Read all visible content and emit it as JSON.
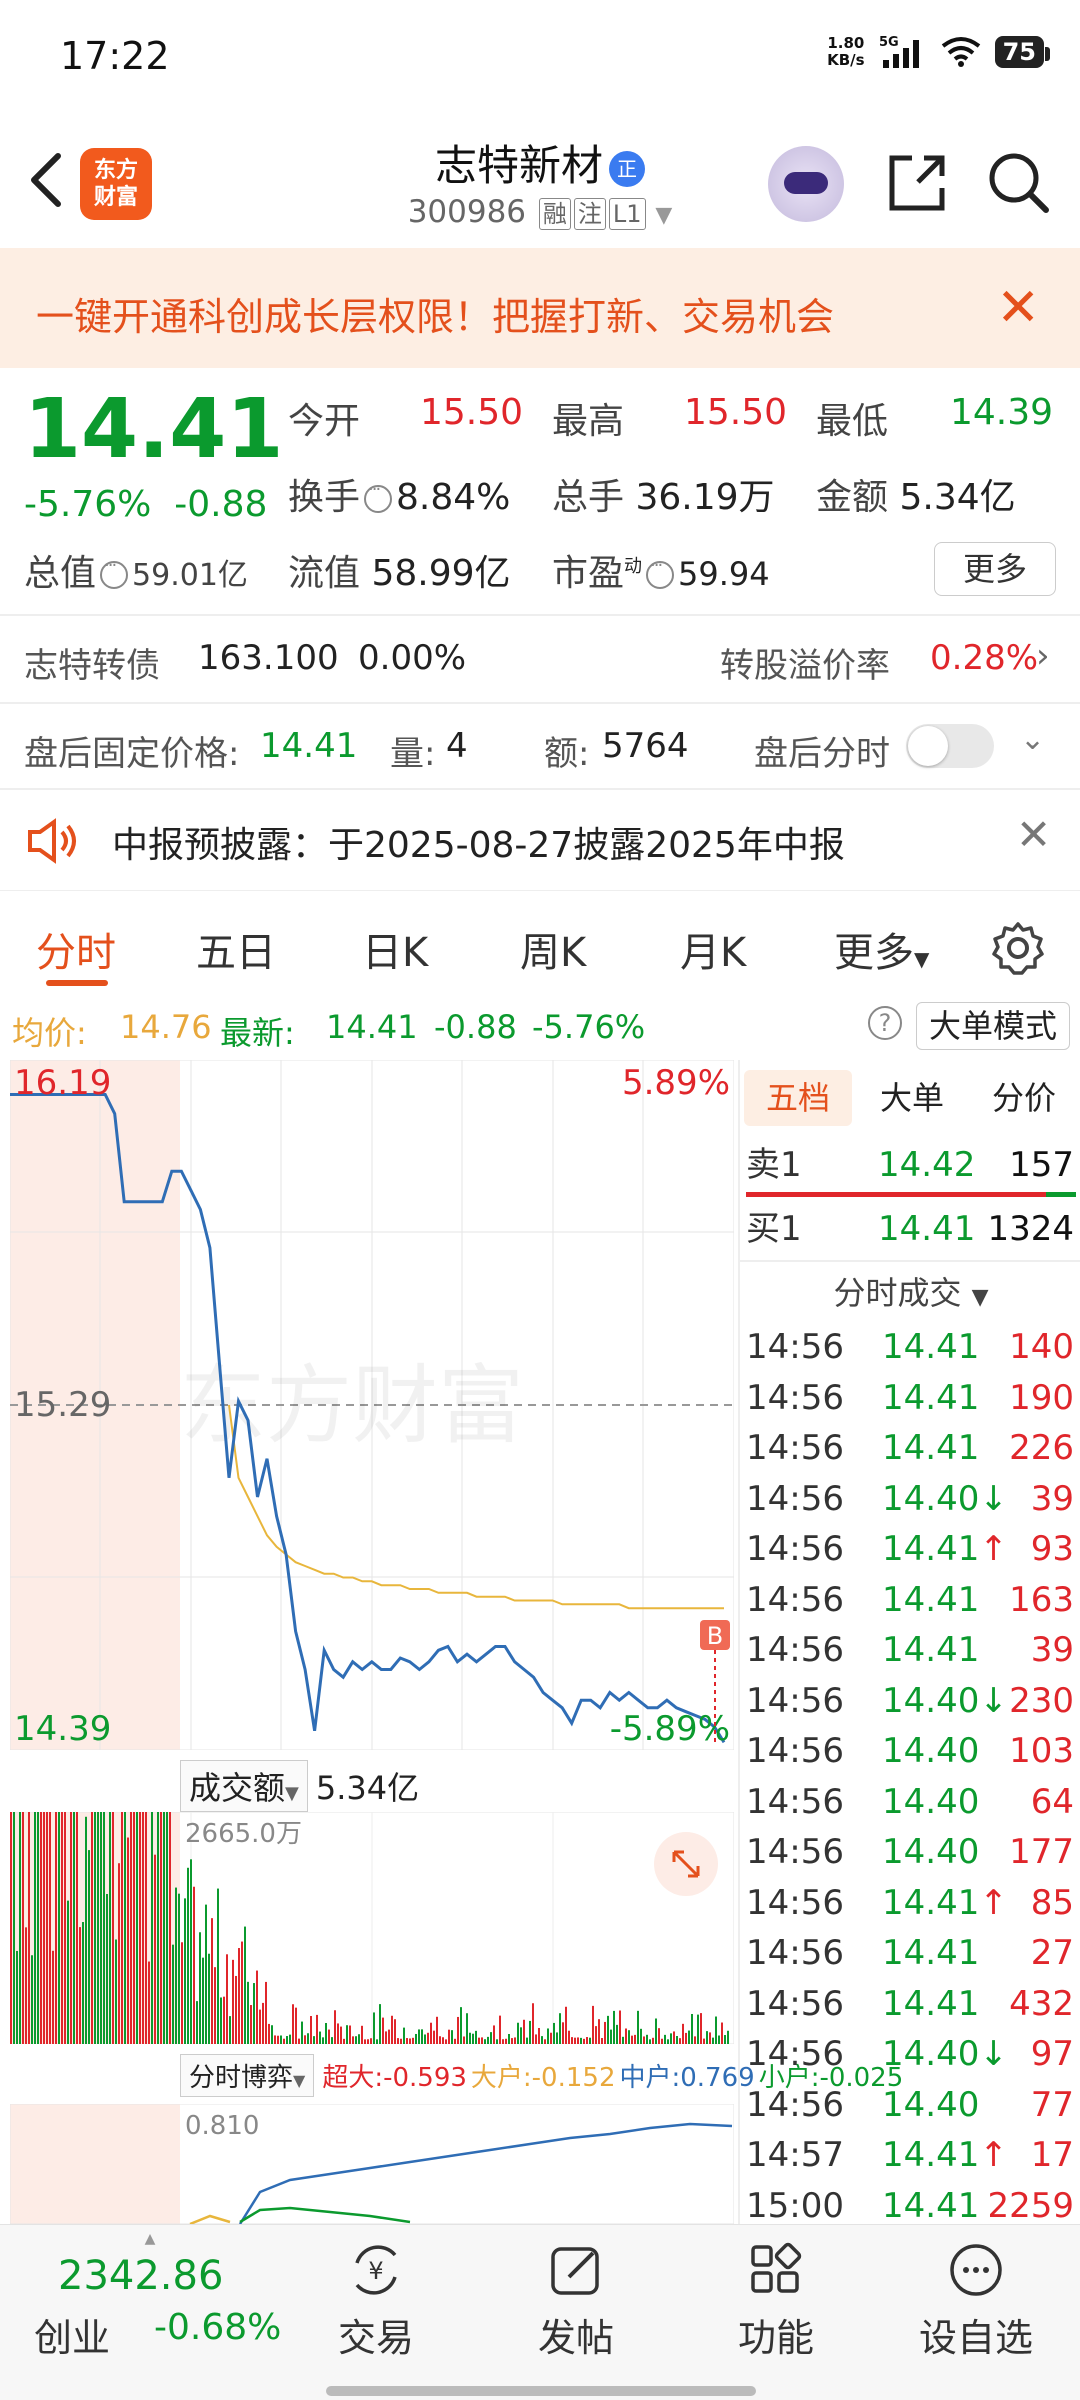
{
  "status": {
    "time": "17:22",
    "net_speed_val": "1.80",
    "net_speed_unit": "KB/s",
    "network": "5G",
    "battery": "75"
  },
  "header": {
    "logo_line1": "东方",
    "logo_line2": "财富",
    "name": "志特新材",
    "name_badge": "正",
    "code": "300986",
    "tags": [
      "融",
      "注",
      "L1"
    ]
  },
  "banner": {
    "text": "一键开通科创成长层权限！把握打新、交易机会"
  },
  "quote": {
    "price": "14.41",
    "change_pct": "-5.76%",
    "change_abs": "-0.88",
    "total_value_label": "总值",
    "total_value": "59.01亿",
    "open_label": "今开",
    "open": "15.50",
    "high_label": "最高",
    "high": "15.50",
    "low_label": "最低",
    "low": "14.39",
    "turnover_label": "换手",
    "turnover": "8.84%",
    "volume_label": "总手",
    "volume": "36.19万",
    "amount_label": "金额",
    "amount": "5.34亿",
    "float_label": "流值",
    "float": "58.99亿",
    "pe_label": "市盈",
    "pe_sup": "动",
    "pe": "59.94",
    "more": "更多"
  },
  "bond": {
    "name": "志特转债",
    "price": "163.100",
    "pct": "0.00%",
    "premium_label": "转股溢价率",
    "premium": "0.28%"
  },
  "after_hours": {
    "price_label": "盘后固定价格:",
    "price": "14.41",
    "vol_label": "量:",
    "vol": "4",
    "amt_label": "额:",
    "amt": "5764",
    "timeshare_label": "盘后分时"
  },
  "notice": {
    "text": "中报预披露：于2025-08-27披露2025年中报"
  },
  "tabs": [
    "分时",
    "五日",
    "日K",
    "周K",
    "月K",
    "更多"
  ],
  "avg": {
    "avg_label": "均价:",
    "avg": "14.76",
    "latest_label": "最新:",
    "latest": "14.41",
    "chg": "-0.88",
    "pct": "-5.76%",
    "mode_button": "大单模式"
  },
  "chart_labels": {
    "high": "16.19",
    "high_pct": "5.89%",
    "mid": "15.29",
    "low": "14.39",
    "low_pct": "-5.89%",
    "watermark": "东方财富",
    "marker": "B"
  },
  "chart_data": {
    "type": "line",
    "title": "",
    "ylim": [
      14.39,
      16.19
    ],
    "series": [
      {
        "name": "price",
        "color": "#2f6db5",
        "values": [
          16.1,
          16.1,
          16.1,
          16.1,
          16.1,
          16.1,
          16.1,
          16.1,
          16.1,
          16.1,
          16.1,
          16.05,
          15.82,
          15.82,
          15.82,
          15.82,
          15.82,
          15.9,
          15.9,
          15.85,
          15.8,
          15.7,
          15.4,
          15.1,
          15.3,
          15.25,
          15.05,
          15.15,
          15.0,
          14.9,
          14.7,
          14.6,
          14.44,
          14.65,
          14.6,
          14.58,
          14.62,
          14.6,
          14.62,
          14.6,
          14.6,
          14.63,
          14.62,
          14.6,
          14.62,
          14.65,
          14.66,
          14.62,
          14.64,
          14.62,
          14.64,
          14.66,
          14.66,
          14.62,
          14.6,
          14.58,
          14.54,
          14.52,
          14.5,
          14.46,
          14.52,
          14.52,
          14.5,
          14.54,
          14.52,
          14.54,
          14.52,
          14.5,
          14.5,
          14.52,
          14.5,
          14.49,
          14.48,
          14.47,
          14.45,
          14.41
        ]
      },
      {
        "name": "avg",
        "color": "#e8b63c",
        "values": [
          null,
          null,
          null,
          null,
          null,
          null,
          null,
          null,
          null,
          null,
          null,
          null,
          null,
          null,
          null,
          null,
          null,
          null,
          null,
          null,
          null,
          null,
          null,
          15.29,
          15.1,
          15.05,
          15.0,
          14.95,
          14.92,
          14.9,
          14.88,
          14.87,
          14.86,
          14.85,
          14.85,
          14.84,
          14.84,
          14.83,
          14.83,
          14.82,
          14.82,
          14.82,
          14.81,
          14.81,
          14.81,
          14.8,
          14.8,
          14.8,
          14.8,
          14.79,
          14.79,
          14.79,
          14.79,
          14.78,
          14.78,
          14.78,
          14.78,
          14.78,
          14.77,
          14.77,
          14.77,
          14.77,
          14.77,
          14.77,
          14.77,
          14.76,
          14.76,
          14.76,
          14.76,
          14.76,
          14.76,
          14.76,
          14.76,
          14.76,
          14.76,
          14.76
        ]
      }
    ]
  },
  "volume": {
    "label": "成交额",
    "total": "5.34亿",
    "max_label": "2665.0万"
  },
  "flow": {
    "label": "分时博弈",
    "super": "超大:-0.593",
    "big": "大户:-0.152",
    "mid": "中户:0.769",
    "small": "小户:-0.025",
    "ymax": "0.810"
  },
  "orderbook": {
    "tabs": [
      "五档",
      "大单",
      "分价"
    ],
    "sell1": {
      "label": "卖1",
      "price": "14.42",
      "vol": "157"
    },
    "buy1": {
      "label": "买1",
      "price": "14.41",
      "vol": "1324"
    },
    "ticks_label": "分时成交",
    "ticks": [
      {
        "t": "14:56",
        "p": "14.41",
        "d": "",
        "v": "140",
        "c": "red"
      },
      {
        "t": "14:56",
        "p": "14.41",
        "d": "",
        "v": "190",
        "c": "red"
      },
      {
        "t": "14:56",
        "p": "14.41",
        "d": "",
        "v": "226",
        "c": "red"
      },
      {
        "t": "14:56",
        "p": "14.40",
        "d": "↓",
        "v": "39",
        "c": "green"
      },
      {
        "t": "14:56",
        "p": "14.41",
        "d": "↑",
        "v": "93",
        "c": "red"
      },
      {
        "t": "14:56",
        "p": "14.41",
        "d": "",
        "v": "163",
        "c": "red"
      },
      {
        "t": "14:56",
        "p": "14.41",
        "d": "",
        "v": "39",
        "c": "red"
      },
      {
        "t": "14:56",
        "p": "14.40",
        "d": "↓",
        "v": "230",
        "c": "green"
      },
      {
        "t": "14:56",
        "p": "14.40",
        "d": "",
        "v": "103",
        "c": "green"
      },
      {
        "t": "14:56",
        "p": "14.40",
        "d": "",
        "v": "64",
        "c": "green"
      },
      {
        "t": "14:56",
        "p": "14.40",
        "d": "",
        "v": "177",
        "c": "green"
      },
      {
        "t": "14:56",
        "p": "14.41",
        "d": "↑",
        "v": "85",
        "c": "red"
      },
      {
        "t": "14:56",
        "p": "14.41",
        "d": "",
        "v": "27",
        "c": "red"
      },
      {
        "t": "14:56",
        "p": "14.41",
        "d": "",
        "v": "432",
        "c": "red"
      },
      {
        "t": "14:56",
        "p": "14.40",
        "d": "↓",
        "v": "97",
        "c": "green"
      },
      {
        "t": "14:56",
        "p": "14.40",
        "d": "",
        "v": "77",
        "c": "green"
      },
      {
        "t": "14:57",
        "p": "14.41",
        "d": "↑",
        "v": "17",
        "c": "red"
      },
      {
        "t": "15:00",
        "p": "14.41",
        "d": "",
        "v": "2259",
        "c": "red"
      }
    ]
  },
  "bottomnav": {
    "index_value": "2342.86",
    "index_name": "创业",
    "index_pct": "-0.68%",
    "items": [
      "交易",
      "发帖",
      "功能",
      "设自选"
    ]
  }
}
